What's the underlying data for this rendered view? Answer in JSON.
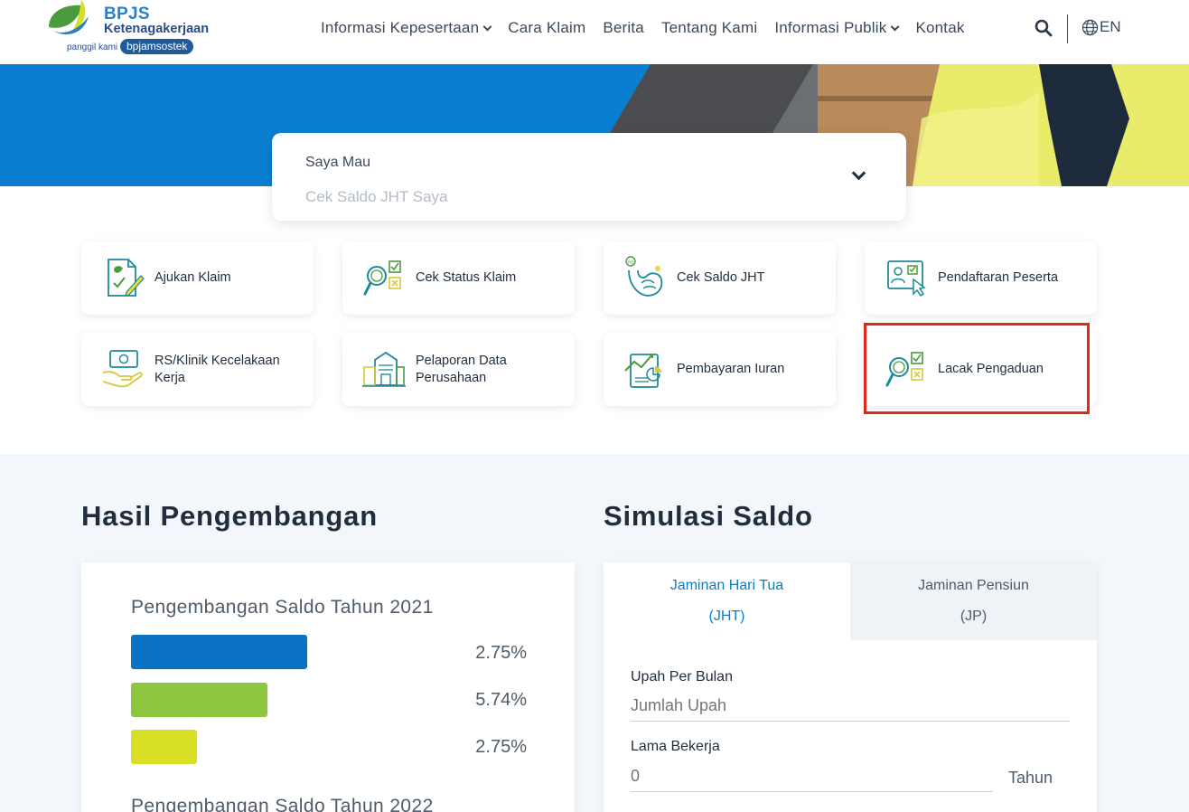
{
  "header": {
    "logo": {
      "title": "BPJS",
      "subtitle": "Ketenagakerjaan",
      "tagline": "panggil kami",
      "pill": "bpjamsostek"
    },
    "nav": [
      {
        "label": "Informasi Kepesertaan",
        "has_dropdown": true
      },
      {
        "label": "Cara Klaim",
        "has_dropdown": false
      },
      {
        "label": "Berita",
        "has_dropdown": false
      },
      {
        "label": "Tentang Kami",
        "has_dropdown": false
      },
      {
        "label": "Informasi Publik",
        "has_dropdown": true
      },
      {
        "label": "Kontak",
        "has_dropdown": false
      }
    ],
    "search_icon": "search-icon",
    "language": "EN"
  },
  "hero": {
    "select_label": "Saya Mau",
    "select_value": "Cek Saldo JHT Saya"
  },
  "services": [
    {
      "label": "Ajukan Klaim",
      "icon": "claim-document-icon"
    },
    {
      "label": "Cek Status Klaim",
      "icon": "magnifier-checklist-icon"
    },
    {
      "label": "Cek Saldo JHT",
      "icon": "piggy-coin-icon"
    },
    {
      "label": "Pendaftaran Peserta",
      "icon": "registration-id-icon"
    },
    {
      "label": "RS/Klinik Kecelakaan Kerja",
      "icon": "hand-money-icon"
    },
    {
      "label": "Pelaporan Data Perusahaan",
      "icon": "building-icon"
    },
    {
      "label": "Pembayaran Iuran",
      "icon": "payment-chart-icon"
    },
    {
      "label": "Lacak Pengaduan",
      "icon": "magnifier-checklist-icon"
    }
  ],
  "colors": {
    "brand_blue": "#0a7fd1",
    "bar_blue": "#0a72c2",
    "bar_green": "#8dc63f",
    "bar_yellow": "#d9df25",
    "highlight_red": "#e1261c"
  },
  "hasil": {
    "title": "Hasil Pengembangan",
    "year1_title": "Pengembangan Saldo Tahun 2021",
    "year2_title": "Pengembangan Saldo Tahun 2022",
    "bars": [
      {
        "value": "2.75%",
        "color": "#0a72c2"
      },
      {
        "value": "5.74%",
        "color": "#8dc63f"
      },
      {
        "value": "2.75%",
        "color": "#d9df25"
      }
    ]
  },
  "simulasi": {
    "title": "Simulasi Saldo",
    "tabs": [
      {
        "line1": "Jaminan Hari Tua",
        "line2": "(JHT)",
        "active": true
      },
      {
        "line1": "Jaminan Pensiun",
        "line2": "(JP)",
        "active": false
      }
    ],
    "upah_label": "Upah Per Bulan",
    "upah_placeholder": "Jumlah Upah",
    "lama_label": "Lama Bekerja",
    "lama_placeholder": "0",
    "lama_unit": "Tahun"
  }
}
